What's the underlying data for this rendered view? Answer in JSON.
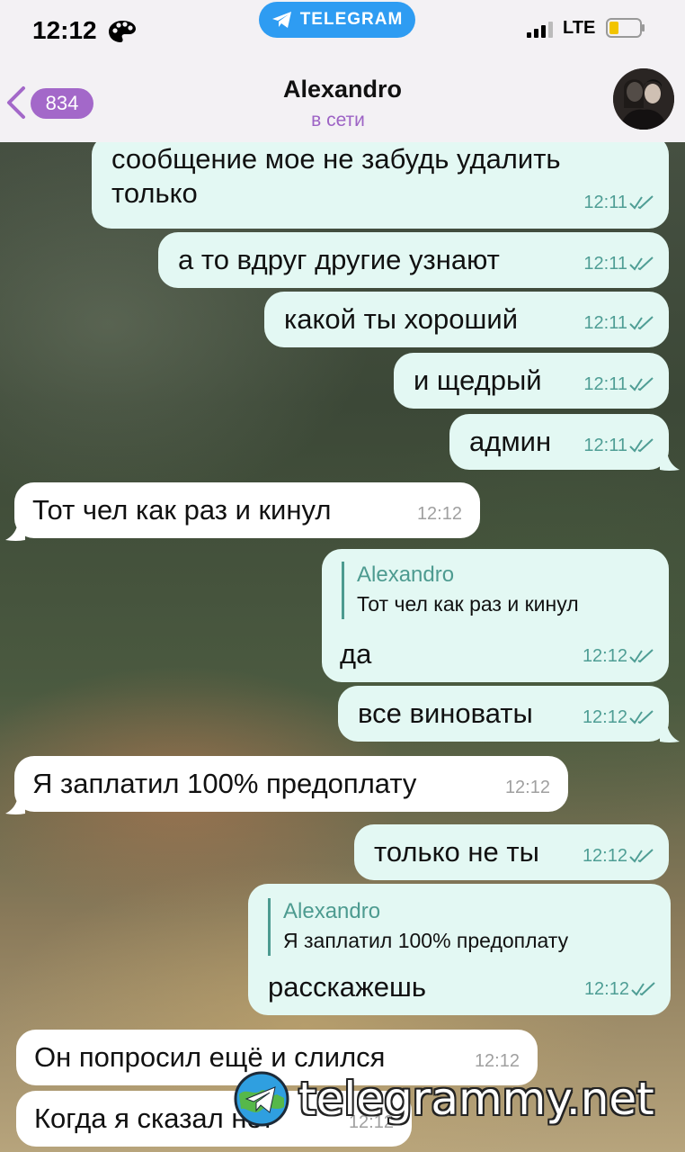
{
  "status_bar": {
    "time": "12:12",
    "app_pill": "TELEGRAM",
    "network": "LTE"
  },
  "header": {
    "back_count": "834",
    "name": "Alexandro",
    "presence": "в сети"
  },
  "messages": [
    {
      "dir": "out",
      "lines": [
        "сообщение мое не забудь удалить",
        "только"
      ],
      "time": "12:11"
    },
    {
      "dir": "out",
      "lines": [
        "а то вдруг другие узнают"
      ],
      "time": "12:11"
    },
    {
      "dir": "out",
      "lines": [
        "какой ты хороший"
      ],
      "time": "12:11"
    },
    {
      "dir": "out",
      "lines": [
        "и щедрый"
      ],
      "time": "12:11"
    },
    {
      "dir": "out",
      "lines": [
        "админ"
      ],
      "time": "12:11"
    },
    {
      "dir": "in",
      "lines": [
        "Тот чел  как раз и кинул"
      ],
      "time": "12:12"
    },
    {
      "dir": "out",
      "reply": {
        "name": "Alexandro",
        "text": "Тот чел как раз и кинул"
      },
      "lines": [
        "да"
      ],
      "time": "12:12"
    },
    {
      "dir": "out",
      "lines": [
        "все виноваты"
      ],
      "time": "12:12"
    },
    {
      "dir": "in",
      "lines": [
        "Я заплатил 100% предоплату"
      ],
      "time": "12:12"
    },
    {
      "dir": "out",
      "lines": [
        "только не ты"
      ],
      "time": "12:12"
    },
    {
      "dir": "out",
      "reply": {
        "name": "Alexandro",
        "text": "Я заплатил 100% предоплату"
      },
      "lines": [
        "расскажешь"
      ],
      "time": "12:12"
    },
    {
      "dir": "in",
      "lines": [
        "Он  попросил ещё и слился"
      ],
      "time": "12:12"
    },
    {
      "dir": "in",
      "lines": [
        "Когда  я сказал нет"
      ],
      "time": "12:12"
    }
  ],
  "watermark": "telegrammy.net",
  "colors": {
    "outgoing_bubble": "#e3f8f3",
    "incoming_bubble": "#ffffff",
    "accent_purple": "#a368c9",
    "telegram_blue": "#2e9cf2",
    "time_green": "#4f9e95"
  }
}
